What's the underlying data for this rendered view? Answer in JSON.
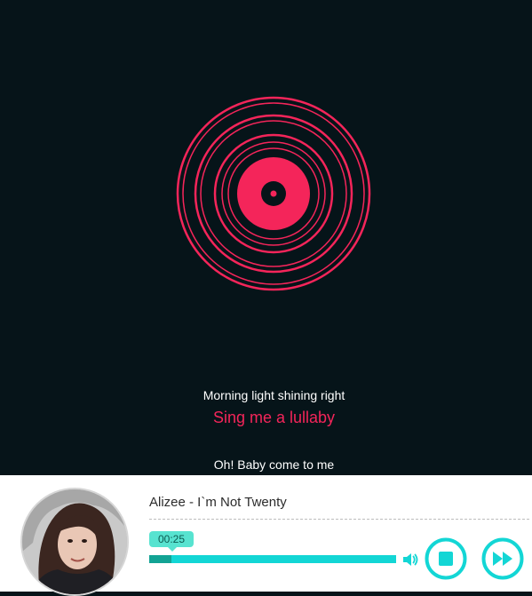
{
  "lyrics": {
    "previous": "Morning light shining right",
    "current": "Sing me a lullaby",
    "next": "Oh! Baby come to me"
  },
  "track": {
    "title": "Alizee - I`m Not Twenty",
    "elapsed": "00:25",
    "progress_fraction": 0.09
  },
  "controls": {
    "volume_icon": "speaker-icon",
    "stop_icon": "stop-icon",
    "next_icon": "fast-forward-icon"
  },
  "colors": {
    "background": "#061419",
    "lyric_active": "#f4255a",
    "disc": "#f4255a",
    "accent": "#13d6d5",
    "progress_played": "#12a394"
  }
}
